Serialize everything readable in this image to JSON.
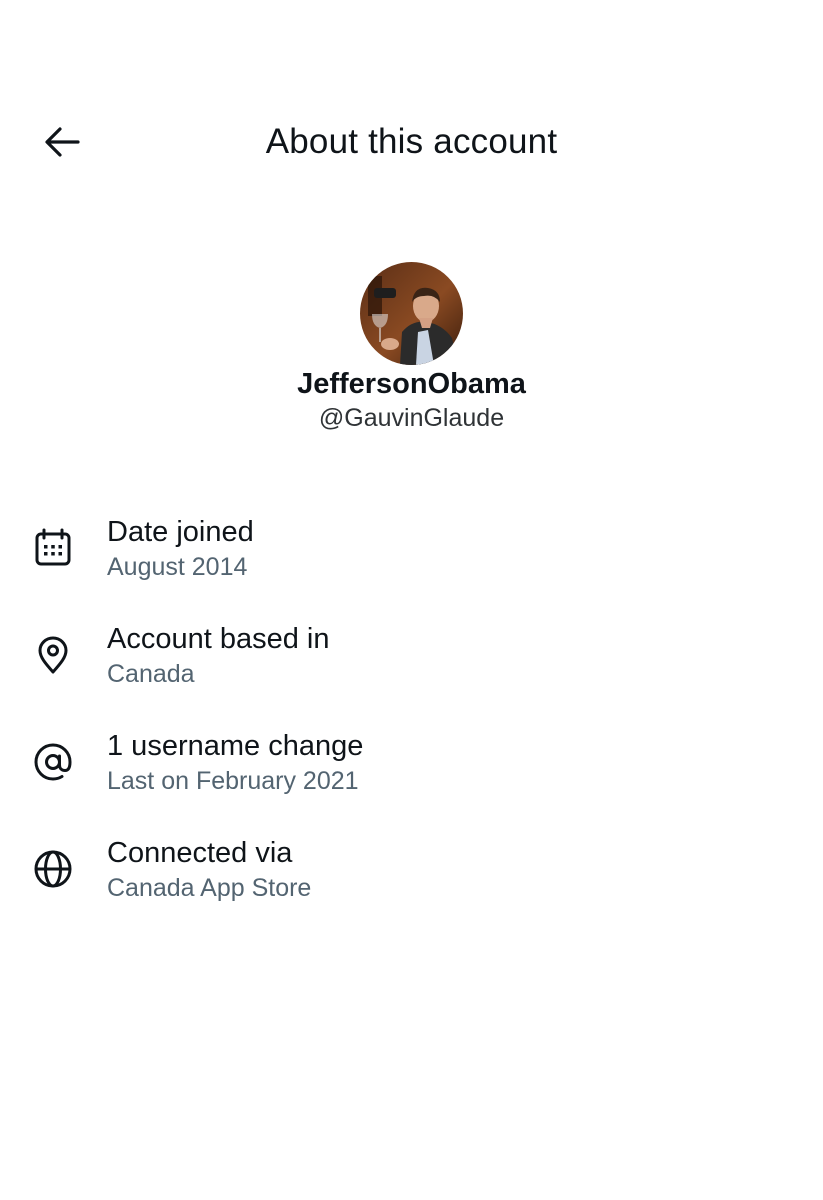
{
  "header": {
    "title": "About this account",
    "back_icon": "arrow-left-icon"
  },
  "profile": {
    "display_name": "JeffersonObama",
    "handle": "@GauvinGlaude",
    "avatar_icon": "profile-photo"
  },
  "info_rows": [
    {
      "icon": "calendar-icon",
      "title": "Date joined",
      "subtitle": "August 2014"
    },
    {
      "icon": "location-pin-icon",
      "title": "Account based in",
      "subtitle": "Canada"
    },
    {
      "icon": "at-sign-icon",
      "title": "1 username change",
      "subtitle": "Last on February 2021"
    },
    {
      "icon": "globe-icon",
      "title": "Connected via",
      "subtitle": "Canada App Store"
    }
  ],
  "colors": {
    "background": "#ffffff",
    "primary_text": "#0f1419",
    "secondary_text": "#536471"
  }
}
